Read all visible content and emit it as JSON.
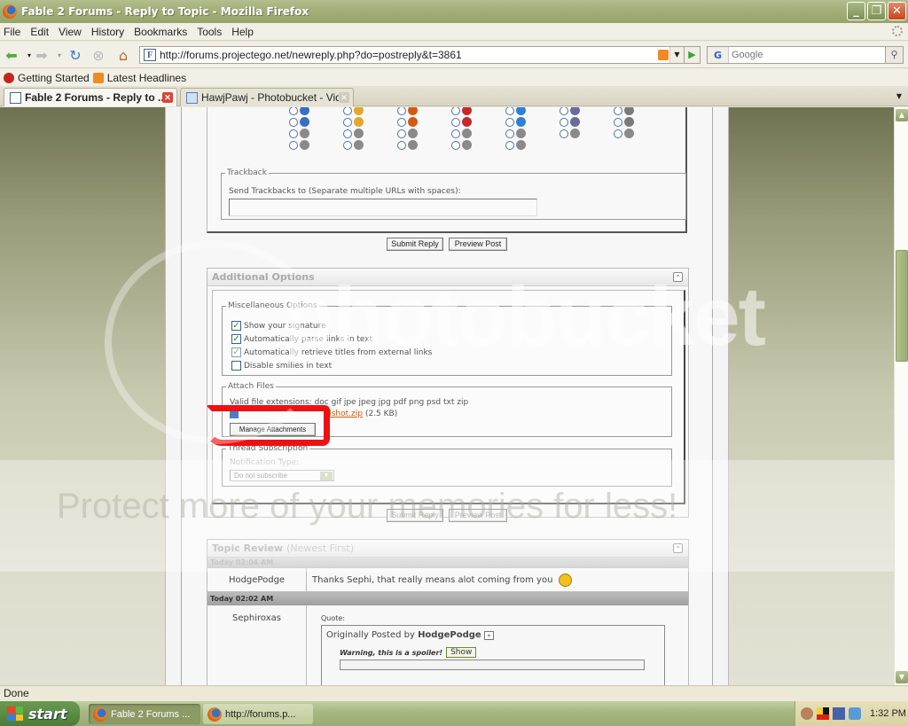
{
  "window": {
    "title": "Fable 2 Forums - Reply to Topic - Mozilla Firefox",
    "controls": [
      "minimize",
      "restore",
      "close"
    ]
  },
  "menu": [
    "File",
    "Edit",
    "View",
    "History",
    "Bookmarks",
    "Tools",
    "Help"
  ],
  "navbar": {
    "url": "http://forums.projectego.net/newreply.php?do=postreply&t=3861",
    "search_placeholder": "Google",
    "search_engine": "G"
  },
  "bookmarks": [
    "Getting Started",
    "Latest Headlines"
  ],
  "tabs": [
    {
      "label": "Fable 2 Forums - Reply to ...",
      "active": true
    },
    {
      "label": "HawjPawj - Photobucket - Vid...",
      "active": false
    }
  ],
  "page": {
    "smilie_grid_rows": 4,
    "trackback": {
      "legend": "Trackback",
      "label": "Send Trackbacks to (Separate multiple URLs with spaces):",
      "value": ""
    },
    "submit_label": "Submit Reply",
    "preview_label": "Preview Post",
    "additional_options": {
      "title": "Additional Options",
      "misc": {
        "legend": "Miscellaneous Options",
        "options": [
          {
            "label": "Show your signature",
            "checked": true
          },
          {
            "label": "Automatically parse links in text",
            "checked": true
          },
          {
            "label": "Automatically retrieve titles from external links",
            "checked": true
          },
          {
            "label": "Disable smilies in text",
            "checked": false
          }
        ]
      },
      "attach": {
        "legend": "Attach Files",
        "valid_extensions": "Valid file extensions: doc gif jpe jpeg jpg pdf png psd txt zip",
        "file_name_visible": "dshot.zip",
        "file_size": "(2.5 KB)",
        "manage_label": "Manage Attachments"
      },
      "subscription": {
        "legend": "Thread Subscription",
        "label": "Notification Type:",
        "selected": "Do not subscribe"
      }
    },
    "topic_review": {
      "title": "Topic Review",
      "subtitle": "(Newest First)",
      "posts": [
        {
          "date": "Today 02:04 AM",
          "user": "HodgePodge",
          "message": "Thanks Sephi, that really means alot coming from you"
        },
        {
          "date": "Today 02:02 AM",
          "user": "Sephiroxas",
          "quote_label": "Quote:",
          "quote_prefix": "Originally Posted by",
          "quote_author": "HodgePodge",
          "spoiler_warning": "Warning, this is a spoiler!",
          "spoiler_button": "Show"
        }
      ]
    }
  },
  "watermark": {
    "brand": "photobucket",
    "tagline": "Protect more of your memories for less!"
  },
  "status": "Done",
  "taskbar": {
    "start_label": "start",
    "tasks": [
      {
        "label": "Fable 2 Forums ...",
        "active": true
      },
      {
        "label": "http://forums.p...",
        "active": false
      }
    ],
    "clock": "1:32 PM"
  }
}
